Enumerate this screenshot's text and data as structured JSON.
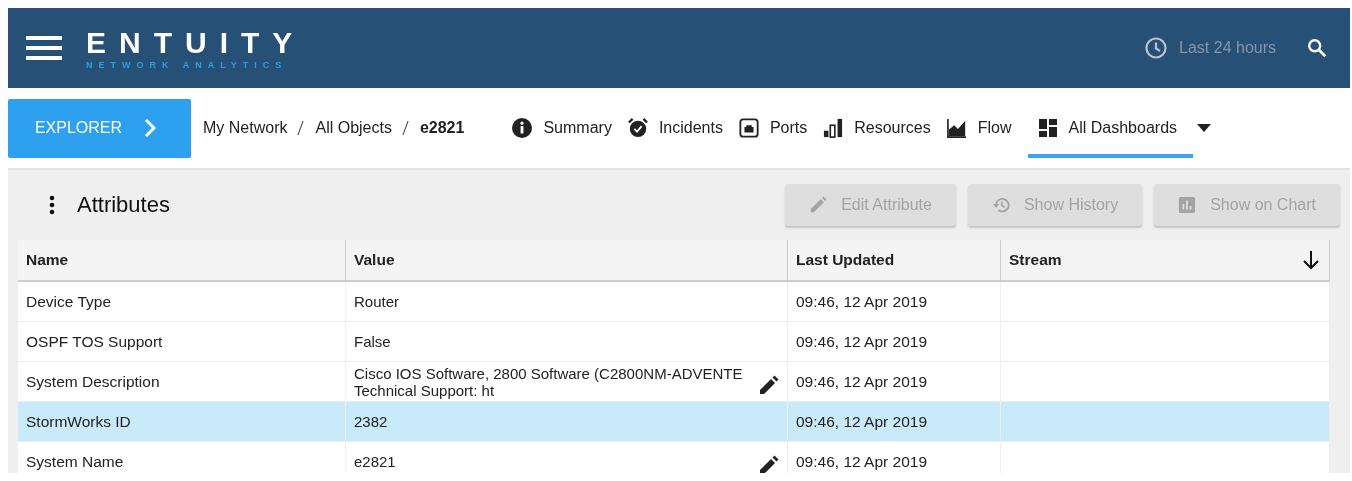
{
  "header": {
    "logo": "ENTUITY",
    "logo_subtitle": "NETWORK ANALYTICS",
    "time_range": "Last 24 hours"
  },
  "explorer_button": "EXPLORER",
  "breadcrumb": [
    {
      "label": "My Network",
      "current": false
    },
    {
      "label": "All Objects",
      "current": false
    },
    {
      "label": "e2821",
      "current": true
    }
  ],
  "tabs": [
    {
      "label": "Summary",
      "kind": "info",
      "selected": false
    },
    {
      "label": "Incidents",
      "kind": "alarm",
      "selected": false
    },
    {
      "label": "Ports",
      "kind": "port",
      "selected": false
    },
    {
      "label": "Resources",
      "kind": "bars",
      "selected": false
    },
    {
      "label": "Flow",
      "kind": "area",
      "selected": false
    },
    {
      "label": "All Dashboards",
      "kind": "grid",
      "selected": true
    }
  ],
  "panel": {
    "title": "Attributes",
    "buttons": [
      {
        "label": "Edit Attribute",
        "kind": "edit",
        "disabled": true
      },
      {
        "label": "Show History",
        "kind": "history",
        "disabled": true
      },
      {
        "label": "Show on Chart",
        "kind": "chart",
        "disabled": true
      }
    ]
  },
  "table": {
    "columns": [
      "Name",
      "Value",
      "Last Updated",
      "Stream"
    ],
    "rows": [
      {
        "name": "Device Type",
        "value": "Router",
        "updated": "09:46, 12 Apr 2019",
        "editable": false,
        "selected": false
      },
      {
        "name": "OSPF TOS Support",
        "value": "False",
        "updated": "09:46, 12 Apr 2019",
        "editable": false,
        "selected": false
      },
      {
        "name": "System Description",
        "value": "Cisco IOS Software, 2800 Software (C2800NM-ADVENTE\nTechnical Support: ht",
        "updated": "09:46, 12 Apr 2019",
        "editable": true,
        "selected": false
      },
      {
        "name": "StormWorks ID",
        "value": "2382",
        "updated": "09:46, 12 Apr 2019",
        "editable": false,
        "selected": true
      },
      {
        "name": "System Name",
        "value": "e2821",
        "updated": "09:46, 12 Apr 2019",
        "editable": true,
        "selected": false
      }
    ]
  }
}
